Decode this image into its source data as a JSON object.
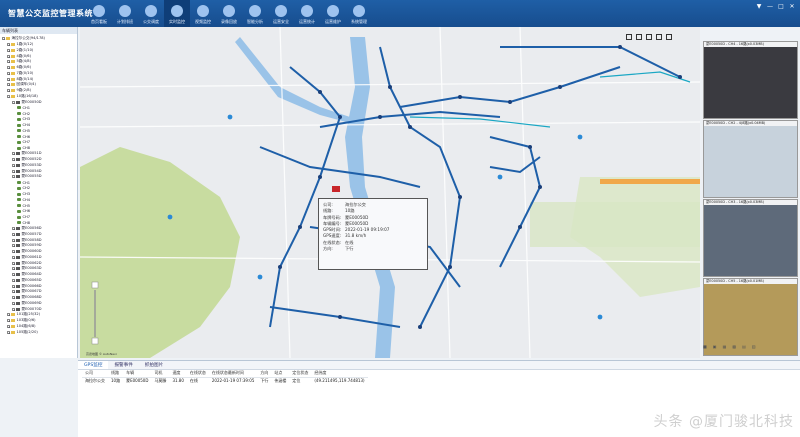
{
  "app": {
    "title": "智慧公交监控管理系统"
  },
  "nav": [
    {
      "label": "首页看板",
      "icon": "dashboard-icon"
    },
    {
      "label": "计划排班",
      "icon": "schedule-icon"
    },
    {
      "label": "公交调度",
      "icon": "dispatch-icon"
    },
    {
      "label": "实时监控",
      "icon": "monitor-icon"
    },
    {
      "label": "视频监控",
      "icon": "video-icon"
    },
    {
      "label": "录像回放",
      "icon": "playback-icon"
    },
    {
      "label": "智能分析",
      "icon": "analysis-icon"
    },
    {
      "label": "运营安全",
      "icon": "security-icon"
    },
    {
      "label": "运营统计",
      "icon": "statistics-icon"
    },
    {
      "label": "运营维护",
      "icon": "maintenance-icon"
    },
    {
      "label": "系统管理",
      "icon": "settings-icon"
    }
  ],
  "window_controls": [
    "▼",
    "—",
    "□",
    "✕"
  ],
  "sidebar": {
    "title": "车辆列表",
    "tree": [
      {
        "label": "海拉尔公交(94/178)",
        "icon": "folder",
        "indent": 0
      },
      {
        "label": "1路(0/12)",
        "icon": "folder",
        "indent": 1
      },
      {
        "label": "2路(1/10)",
        "icon": "folder",
        "indent": 1
      },
      {
        "label": "4路(0/6)",
        "icon": "folder",
        "indent": 1
      },
      {
        "label": "5路(4/8)",
        "icon": "folder",
        "indent": 1
      },
      {
        "label": "6路(0/6)",
        "icon": "folder",
        "indent": 1
      },
      {
        "label": "7路(0/10)",
        "icon": "folder",
        "indent": 1
      },
      {
        "label": "8路(0/14)",
        "icon": "folder",
        "indent": 1
      },
      {
        "label": "回调车(0/4)",
        "icon": "folder",
        "indent": 1
      },
      {
        "label": "9路(2/8)",
        "icon": "folder",
        "indent": 1
      },
      {
        "label": "10路(16/18)",
        "icon": "folder",
        "indent": 1
      },
      {
        "label": "蒙E00050D",
        "icon": "bus",
        "indent": 2
      },
      {
        "label": "CH1",
        "icon": "cam",
        "indent": 3
      },
      {
        "label": "CH2",
        "icon": "cam",
        "indent": 3
      },
      {
        "label": "CH3",
        "icon": "cam",
        "indent": 3
      },
      {
        "label": "CH4",
        "icon": "cam",
        "indent": 3
      },
      {
        "label": "CH5",
        "icon": "cam",
        "indent": 3
      },
      {
        "label": "CH6",
        "icon": "cam",
        "indent": 3
      },
      {
        "label": "CH7",
        "icon": "cam",
        "indent": 3
      },
      {
        "label": "CH8",
        "icon": "cam",
        "indent": 3
      },
      {
        "label": "蒙E00051D",
        "icon": "bus",
        "indent": 2
      },
      {
        "label": "蒙E00052D",
        "icon": "bus",
        "indent": 2
      },
      {
        "label": "蒙E00053D",
        "icon": "bus",
        "indent": 2
      },
      {
        "label": "蒙E00054D",
        "icon": "bus",
        "indent": 2
      },
      {
        "label": "蒙E00055D",
        "icon": "bus",
        "indent": 2
      },
      {
        "label": "CH1",
        "icon": "cam",
        "indent": 3
      },
      {
        "label": "CH2",
        "icon": "cam",
        "indent": 3
      },
      {
        "label": "CH3",
        "icon": "cam",
        "indent": 3
      },
      {
        "label": "CH4",
        "icon": "cam",
        "indent": 3
      },
      {
        "label": "CH5",
        "icon": "cam",
        "indent": 3
      },
      {
        "label": "CH6",
        "icon": "cam",
        "indent": 3
      },
      {
        "label": "CH7",
        "icon": "cam",
        "indent": 3
      },
      {
        "label": "CH8",
        "icon": "cam",
        "indent": 3
      },
      {
        "label": "蒙E00056D",
        "icon": "bus",
        "indent": 2
      },
      {
        "label": "蒙E00057D",
        "icon": "bus",
        "indent": 2
      },
      {
        "label": "蒙E00058D",
        "icon": "bus",
        "indent": 2
      },
      {
        "label": "蒙E00059D",
        "icon": "bus",
        "indent": 2
      },
      {
        "label": "蒙E00060D",
        "icon": "bus",
        "indent": 2
      },
      {
        "label": "蒙E00061D",
        "icon": "bus",
        "indent": 2
      },
      {
        "label": "蒙E00062D",
        "icon": "bus",
        "indent": 2
      },
      {
        "label": "蒙E00063D",
        "icon": "bus",
        "indent": 2
      },
      {
        "label": "蒙E00064D",
        "icon": "bus",
        "indent": 2
      },
      {
        "label": "蒙E00065D",
        "icon": "bus",
        "indent": 2
      },
      {
        "label": "蒙E00066D",
        "icon": "bus",
        "indent": 2
      },
      {
        "label": "蒙E00067D",
        "icon": "bus",
        "indent": 2
      },
      {
        "label": "蒙E00068D",
        "icon": "bus",
        "indent": 2
      },
      {
        "label": "蒙E00069D",
        "icon": "bus",
        "indent": 2
      },
      {
        "label": "蒙E00070D",
        "icon": "bus",
        "indent": 2
      },
      {
        "label": "101路(25/32)",
        "icon": "folder",
        "indent": 1
      },
      {
        "label": "103路(0/6)",
        "icon": "folder",
        "indent": 1
      },
      {
        "label": "104路(6/8)",
        "icon": "folder",
        "indent": 1
      },
      {
        "label": "105路(2/20)",
        "icon": "folder",
        "indent": 1
      }
    ]
  },
  "map": {
    "popup": {
      "rows": [
        {
          "key": "公司:",
          "value": "海拉尔公交"
        },
        {
          "key": "线路:",
          "value": "10路"
        },
        {
          "key": "车牌号码:",
          "value": "蒙E00050D"
        },
        {
          "key": "车辆编号:",
          "value": "蒙E00050D"
        },
        {
          "key": "GPS时间:",
          "value": "2022-01-19 09:19:07"
        },
        {
          "key": "GPS速度:",
          "value": "31.8 km/h"
        },
        {
          "key": "在线状态:",
          "value": "在线"
        },
        {
          "key": "方向:",
          "value": "下行"
        }
      ]
    },
    "footer": "高德地图 © AutoNavi"
  },
  "cameras": [
    {
      "label": "蒙E00050D - CH4 - 16路(x0.03MB)",
      "bg": "#3a3a40"
    },
    {
      "label": "蒙E00050D - CH2 - 4(8路(x0.04MB)",
      "bg": "#c7d2dc"
    },
    {
      "label": "蒙E00050D - CH3 - 16路(x0.03MB)",
      "bg": "#5e6a7a"
    },
    {
      "label": "蒙E00050D - CH5 - 16路(x0.01MB)",
      "bg": "#b49a5a"
    }
  ],
  "right_footer": [
    "■",
    "▣",
    "▦",
    "▩",
    "▤",
    "▥"
  ],
  "bottom": {
    "tabs": [
      "GPS监控",
      "报警事件",
      "抓拍图片"
    ],
    "columns": [
      "公司",
      "线路",
      "车辆",
      "司机",
      "速度",
      "在线状态",
      "在线状态最新时间",
      "方向",
      "站点",
      "定位状态",
      "经纬度"
    ],
    "rows": [
      [
        "海拉尔公交",
        "10路",
        "蒙E00050D",
        "马莫滕",
        "31.80",
        "在线",
        "2022-01-19 07:39:05",
        "下行",
        "伟涵楼",
        "定位",
        "(49.211495,119.744813)"
      ]
    ]
  },
  "watermark": "头条 @厦门骏北科技",
  "colors": {
    "accent": "#1f5fa6",
    "route": "#1e5fa8",
    "stop": "#1a3f7a",
    "green": "#c8dca0",
    "water": "#9ac3e8"
  }
}
